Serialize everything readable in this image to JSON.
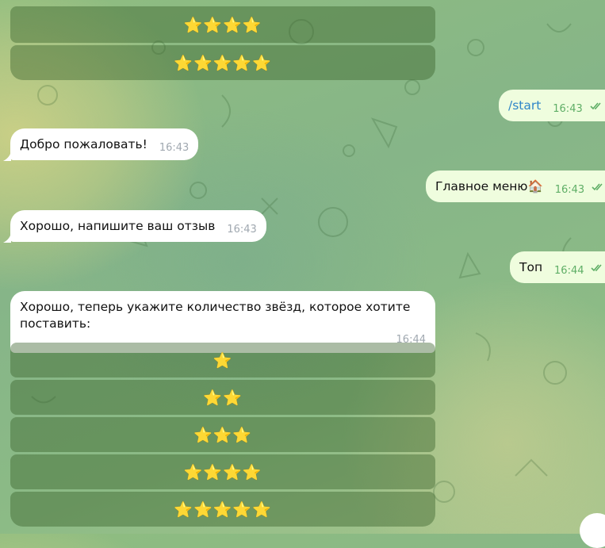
{
  "top_keyboard": {
    "buttons": [
      "⭐⭐⭐⭐",
      "⭐⭐⭐⭐⭐"
    ]
  },
  "messages": [
    {
      "id": "m1",
      "direction": "out",
      "text": "/start",
      "time": "16:43"
    },
    {
      "id": "m2",
      "direction": "in",
      "text": "Добро пожаловать!",
      "time": "16:43"
    },
    {
      "id": "m3",
      "direction": "out",
      "text": "Главное меню🏠",
      "time": "16:43"
    },
    {
      "id": "m4",
      "direction": "in",
      "text": "Хорошо, напишите ваш отзыв",
      "time": "16:43"
    },
    {
      "id": "m5",
      "direction": "out",
      "text": "Топ",
      "time": "16:44"
    },
    {
      "id": "m6",
      "direction": "in",
      "text": "Хорошо, теперь укажите количество звёзд, которое хотите поставить:",
      "time": "16:44"
    }
  ],
  "rating_keyboard": {
    "buttons": [
      "⭐",
      "⭐⭐",
      "⭐⭐⭐",
      "⭐⭐⭐⭐",
      "⭐⭐⭐⭐⭐"
    ]
  },
  "colors": {
    "incoming_bubble": "#ffffff",
    "outgoing_bubble": "#effdde",
    "outgoing_time": "#5fae66",
    "command_link": "#2f86c8",
    "keyboard_button": "#386028"
  },
  "icons": {
    "read_receipt": "double-check-icon",
    "scroll_down": "scroll-down-button"
  }
}
